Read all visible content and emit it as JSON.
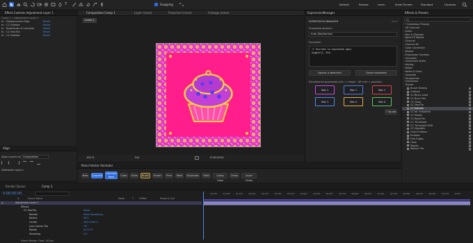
{
  "workspace_tabs": [
    "Default",
    "Review",
    "Learn",
    "Small Screen",
    "Standard",
    "Libraries"
  ],
  "toolbar": {
    "snapping_label": "Snapping"
  },
  "effect_controls": {
    "tab_label": "Effect Controls Adjustment Layer 1",
    "subtitle": "Comp 1 • Adjustment Layer 1",
    "effects": [
      {
        "name": "Displacement Map",
        "value": "Reset"
      },
      {
        "name": "CC Kaleida",
        "value": "Reset"
      },
      {
        "name": "Brightness & Contrast",
        "value": "Reset"
      },
      {
        "name": "CC HexTile",
        "value": "Reset"
      },
      {
        "name": "CC Kaleida",
        "value": "Reset"
      }
    ]
  },
  "viewer_tabs": [
    "Composition Comp 1",
    "Layer (none)",
    "Flowchart (none)",
    "Footage (none)"
  ],
  "comp_chip": "Comp 1",
  "viewer_footer": {
    "zoom": "100 %",
    "quality": "Full",
    "timecode": "0:00:00:00"
  },
  "align": {
    "title": "Align",
    "align_layers_to_label": "Align Layers to:",
    "align_to_value": "Composition",
    "distribute_label": "Distribute Layers:"
  },
  "expression_manager": {
    "tab_label": "ExpressionManager",
    "header": "EXPRESSION MANAGER",
    "version": "v1.0",
    "property_label": "Propiedad objetivo",
    "property_value": "Auto (Keyframes)",
    "expression_label": "Expresión",
    "expression_text": "// Escribe la expresión aquí\nwiggle(2, 50);",
    "apply_button": "Aplicar a selección",
    "remove_button": "Quitar expresión",
    "saved_label": "Expresiones guardadas (clic = cargar · Alt+clic = guardar)",
    "slots": [
      {
        "label": "Slot 1",
        "color": "#c64bd8"
      },
      {
        "label": "Slot 1",
        "color": "#4c7fe0"
      },
      {
        "label": "Slot 1",
        "color": "#e0424b"
      },
      {
        "label": "Slot 1",
        "color": "#4c8fe8"
      },
      {
        "label": "Slot 4",
        "color": "#e0b23c"
      },
      {
        "label": "Slot 4",
        "color": "#5ac95a"
      }
    ],
    "help_label": "? Ayuda"
  },
  "effects_presets": {
    "title": "Effects & Presets",
    "categories": [
      "* Animation Presets",
      "3D Channel",
      "Audio",
      "Blur & Sharpen",
      "Boris FX Mocha",
      "Channel",
      "Cinema 4D",
      "Color Correction",
      "Distort",
      "Expression Controls",
      "Generate",
      "Immersive Video",
      "Keying",
      "Matte",
      "Noise & Grain",
      "Obsolete",
      "Perspective",
      "Simulation",
      "Stylize"
    ],
    "stylize_items": [
      "Brush Strokes",
      "Cartoon",
      "CC Block Load",
      "CC Burn Film",
      "CC Glass",
      "CC HexTile",
      "CC Kaleida",
      "CC Mr. Smoothie",
      "CC Plastic",
      "CC RepeTile",
      "CC Threshold",
      "CC Threshold RGB",
      "CC Vignette",
      "Color Emboss",
      "Emboss",
      "Find Edges",
      "Glow",
      "Mosaic",
      "Motion Tile"
    ],
    "selected_item": "CC Kaleida"
  },
  "pencil_animator": {
    "title": "Pencil Vector Animator",
    "buttons": [
      "New",
      "Connect",
      "Connect Next",
      "Clear",
      "Undo",
      "Brush",
      "Eraser",
      "Prev",
      "Next",
      "Duplicate",
      "Hold",
      "Comp View",
      "Onion",
      "Layer Onion"
    ]
  },
  "timeline": {
    "tabs": [
      "Render Queue",
      "Comp 1"
    ],
    "timecode": "0:00:00:00",
    "columns": [
      "#",
      "Source Name",
      "Mode",
      "T",
      "TrkMat",
      "Parent & Link"
    ],
    "rows": [
      {
        "name": "Adjustment Layer 1",
        "value": "",
        "highlight": true
      },
      {
        "name": "Effects",
        "value": ""
      },
      {
        "name": "CC HexTile",
        "value": "Reset"
      },
      {
        "name": "Render",
        "value": "Solid Seamlessly"
      },
      {
        "name": "Radius",
        "value": "36.0"
      },
      {
        "name": "Center",
        "value": "540.0,540.0"
      },
      {
        "name": "Lock Center Tile",
        "value": "Off"
      },
      {
        "name": "Rotate",
        "value": "0x+0.0°"
      },
      {
        "name": "Smearing",
        "value": "0.0"
      }
    ],
    "ruler": [
      "00:15f",
      "01:00f",
      "01:15f",
      "02:00f",
      "02:15f",
      "03:00f",
      "03:15f",
      "04:00f",
      "04:15f",
      "05:00f",
      "05:15f",
      "06:00f",
      "06:15f",
      "07:00f",
      "07:15f",
      "08:00f",
      "08:15f",
      "09:00f",
      "09:15f",
      "10:00"
    ],
    "frame_render_time": "Frame Render Time: 141ms"
  }
}
